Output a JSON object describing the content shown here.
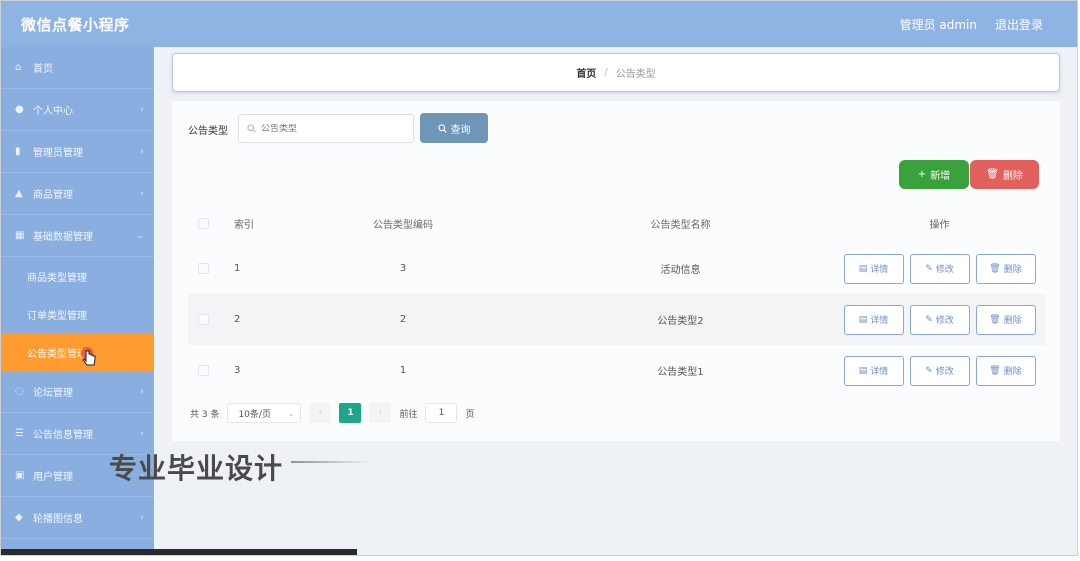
{
  "header": {
    "app_title": "微信点餐小程序",
    "user_label": "管理员 admin",
    "logout_label": "退出登录"
  },
  "sidebar": {
    "items": [
      {
        "label": "首页",
        "icon": "home-icon"
      },
      {
        "label": "个人中心",
        "icon": "user-icon"
      },
      {
        "label": "管理员管理",
        "icon": "bar-chart-icon"
      },
      {
        "label": "商品管理",
        "icon": "cart-icon"
      },
      {
        "label": "基础数据管理",
        "icon": "grid-icon"
      }
    ],
    "sub_items": [
      {
        "label": "商品类型管理"
      },
      {
        "label": "订单类型管理"
      },
      {
        "label": "公告类型管理",
        "active": true
      }
    ],
    "items_after": [
      {
        "label": "论坛管理",
        "icon": "chat-icon"
      },
      {
        "label": "公告信息管理",
        "icon": "list-icon"
      },
      {
        "label": "用户管理",
        "icon": "users-icon"
      },
      {
        "label": "轮播图信息",
        "icon": "image-icon"
      }
    ]
  },
  "breadcrumb": {
    "home": "首页",
    "separator": "/",
    "current": "公告类型"
  },
  "search": {
    "label": "公告类型",
    "placeholder": "公告类型",
    "query_button": "查询"
  },
  "actions": {
    "add_label": "新增",
    "delete_label": "删除"
  },
  "table": {
    "headers": [
      "索引",
      "公告类型编码",
      "公告类型名称",
      "操作"
    ],
    "rows": [
      {
        "index": "1",
        "code": "3",
        "name": "活动信息"
      },
      {
        "index": "2",
        "code": "2",
        "name": "公告类型2"
      },
      {
        "index": "3",
        "code": "1",
        "name": "公告类型1"
      }
    ],
    "row_actions": {
      "detail": "详情",
      "edit": "修改",
      "delete": "删除"
    }
  },
  "pagination": {
    "total_text": "共 3 条",
    "page_size": "10条/页",
    "current_page": "1",
    "goto_label": "前往",
    "goto_value": "1",
    "page_suffix": "页"
  },
  "watermark": "专业毕业设计",
  "colors": {
    "topbar": "#8fb3e3",
    "sidebar": "#89aedf",
    "active_menu": "#ff9b31",
    "query_button": "#6d96b7",
    "add_button": "#3aa13d",
    "delete_button": "#e15f5d",
    "current_page": "#1ea58a"
  }
}
